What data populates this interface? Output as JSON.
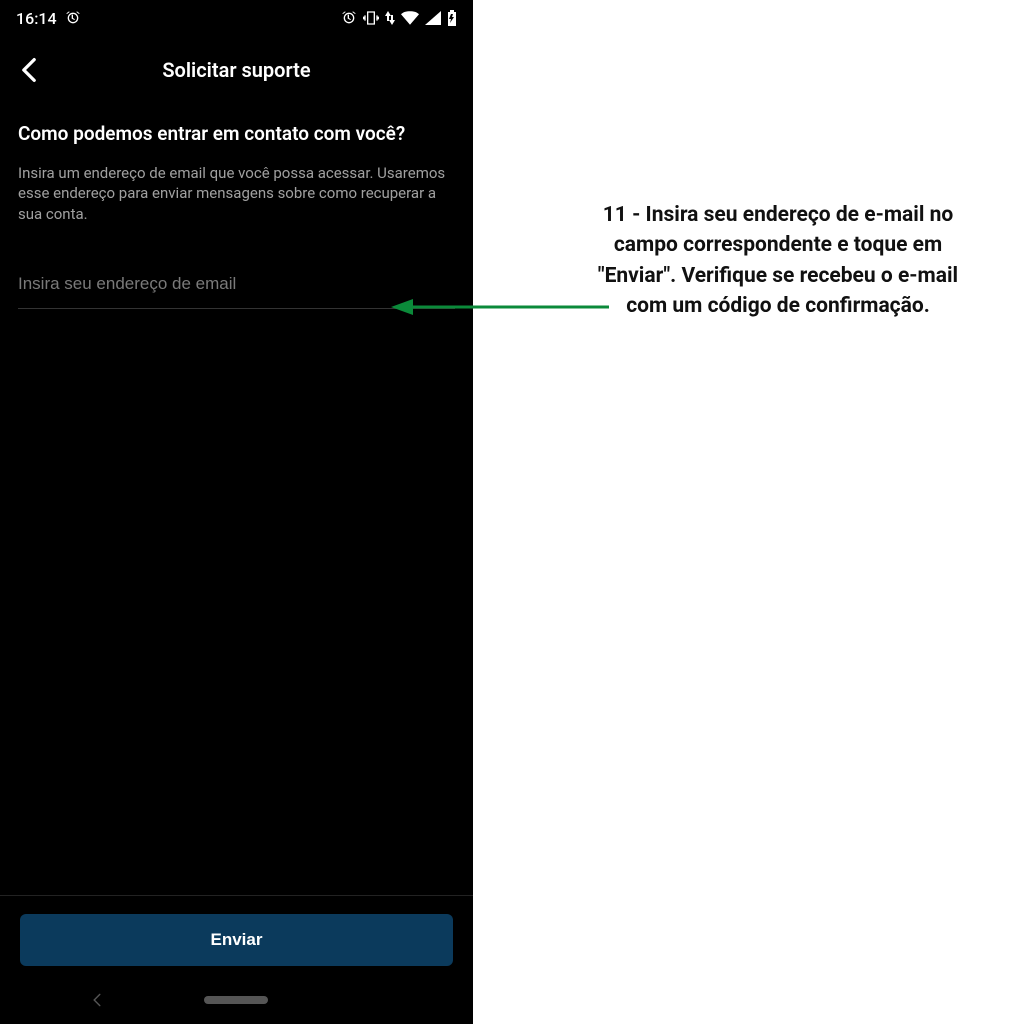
{
  "status_bar": {
    "time": "16:14"
  },
  "header": {
    "title": "Solicitar suporte"
  },
  "main": {
    "question": "Como podemos entrar em contato com você?",
    "description": "Insira um endereço de email que você possa acessar. Usaremos esse endereço para enviar mensagens sobre como recuperar a sua conta.",
    "email_placeholder": "Insira seu endereço de email"
  },
  "footer": {
    "submit_label": "Enviar"
  },
  "annotation": {
    "text": "11 - Insira seu endereço de e-mail no campo correspondente e toque em \"Enviar\". Verifique se recebeu o e-mail com um código de confirmação.",
    "arrow_color": "#0b8a3a"
  }
}
